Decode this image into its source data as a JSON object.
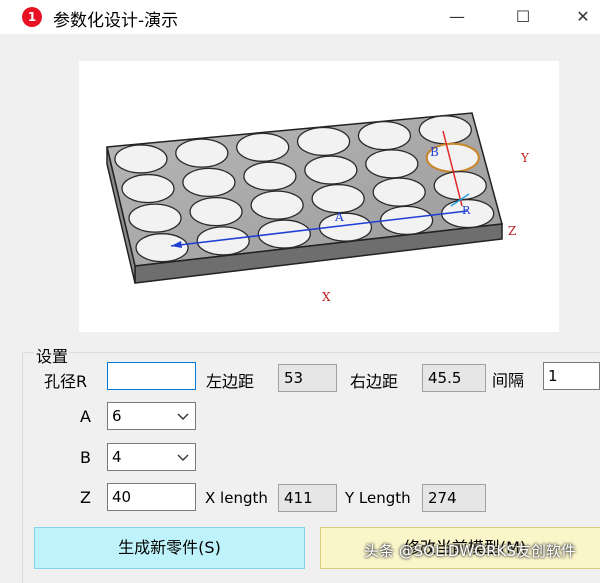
{
  "window": {
    "title": "参数化设计-演示",
    "badge": "1",
    "min_glyph": "—",
    "max_glyph": "☐",
    "close_glyph": "✕"
  },
  "preview": {
    "label_x": "X",
    "label_y": "Y",
    "label_z": "Z",
    "label_a": "A",
    "label_b": "B",
    "label_r": "R",
    "plate_color": "#d0d0d0",
    "hole_color": "#f2f2f2",
    "axis_color": "#1f3fd4",
    "marker_color": "#e02828",
    "label_color": "#c22020",
    "highlight_color": "#c9852a"
  },
  "settings": {
    "group_label": "设置",
    "hole_radius_label": "孔径R",
    "hole_radius_value": "",
    "left_margin_label": "左边距",
    "left_margin_value": "53",
    "right_margin_label": "右边距",
    "right_margin_value": "45.5",
    "spacing_label": "间隔",
    "spacing_value": "1",
    "a_label": "A",
    "a_value": "6",
    "b_label": "B",
    "b_value": "4",
    "z_label": "Z",
    "z_value": "40",
    "x_length_label": "X length",
    "x_length_value": "411",
    "y_length_label": "Y Length",
    "y_length_value": "274"
  },
  "buttons": {
    "generate_label": "生成新零件(S)",
    "modify_label": "修改当前模型(M)",
    "generate_color": "#bff3fb",
    "modify_color": "#fbf6c9"
  },
  "watermark": "头条 @SOLIDWORKS友创软件"
}
